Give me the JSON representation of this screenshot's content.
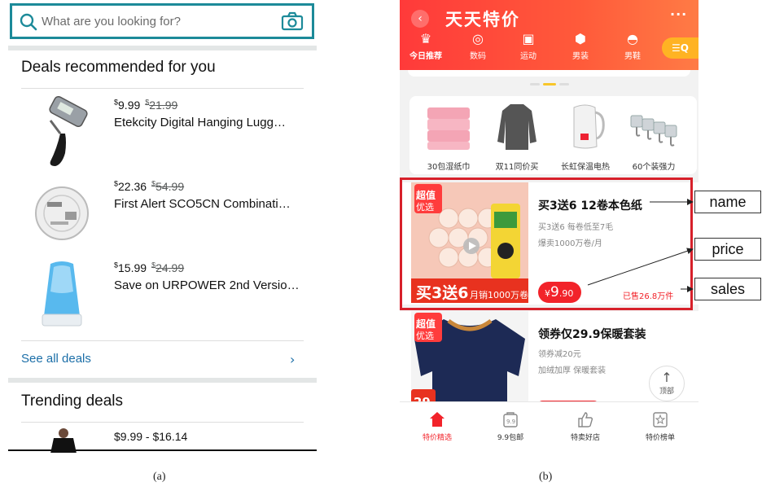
{
  "panel_a": {
    "search": {
      "placeholder": "What are you looking for?",
      "icon": "search-icon",
      "camera_icon": "camera-icon"
    },
    "deals_title": "Deals recommended for you",
    "deals": [
      {
        "price_symbol": "$",
        "price": "9.99",
        "old_symbol": "$",
        "old_price": "21.99",
        "name": "Etekcity Digital Hanging Lugg…",
        "image": "luggage-scale-image"
      },
      {
        "price_symbol": "$",
        "price": "22.36",
        "old_symbol": "$",
        "old_price": "54.99",
        "name": "First Alert SCO5CN Combinati…",
        "image": "smoke-alarm-image"
      },
      {
        "price_symbol": "$",
        "price": "15.99",
        "old_symbol": "$",
        "old_price": "24.99",
        "name": "Save on URPOWER 2nd Versio…",
        "image": "diffuser-image"
      }
    ],
    "see_all": "See all deals",
    "trending_title": "Trending deals",
    "trending": [
      {
        "price_range": "$9.99 - $16.14",
        "price_from": "9.99",
        "price_to": "16.14",
        "image": "dress-image"
      }
    ],
    "caption": "(a)"
  },
  "panel_b": {
    "title": "天天特价",
    "categories": [
      {
        "label": "今日推荐",
        "icon": "crown-icon",
        "active": true
      },
      {
        "label": "数码",
        "icon": "camera-icon"
      },
      {
        "label": "运动",
        "icon": "backpack-icon"
      },
      {
        "label": "男装",
        "icon": "shirt-icon"
      },
      {
        "label": "男鞋",
        "icon": "shoe-icon"
      }
    ],
    "filter_label": "☰Q",
    "mini_items": [
      {
        "label": "30包湿纸巾",
        "image": "wet-wipes-image"
      },
      {
        "label": "双11同价买",
        "image": "sweater-image"
      },
      {
        "label": "长虹保温电热",
        "image": "kettle-image"
      },
      {
        "label": "60个装强力",
        "image": "hooks-image"
      }
    ],
    "products": [
      {
        "badge_top": "超值",
        "badge_bottom": "优选",
        "banner": "买3送6",
        "banner_sub": "月销1000万卷",
        "name": "买3送6 12卷本色纸",
        "sub1": "买3送6 每卷低至7毛",
        "sub2": "爆卖1000万卷/月",
        "price_symbol": "¥",
        "price_int": "9",
        "price_dec": ".90",
        "sold": "已售26.8万件"
      },
      {
        "badge_top": "超值",
        "badge_bottom": "优选",
        "price_mini": "29",
        "name": "领券仅29.9保暖套装",
        "sub1": "领券减20元",
        "sub2": "加绒加厚 保暖套装"
      }
    ],
    "top_button": "顶部",
    "tabs": [
      {
        "label": "特价精选",
        "icon": "home-icon",
        "active": true
      },
      {
        "label": "9.9包邮",
        "icon": "price-99-icon"
      },
      {
        "label": "特卖好店",
        "icon": "thumbs-up-icon"
      },
      {
        "label": "特价榜单",
        "icon": "star-ranking-icon"
      }
    ],
    "caption": "(b)"
  },
  "annotations": [
    {
      "label": "name"
    },
    {
      "label": "price"
    },
    {
      "label": "sales"
    }
  ],
  "colors": {
    "search_border": "#1c8a99",
    "link": "#1c6fa8",
    "brand_red": "#f2232a",
    "header_orange": "#ff7b45",
    "highlight": "#d7202a"
  }
}
